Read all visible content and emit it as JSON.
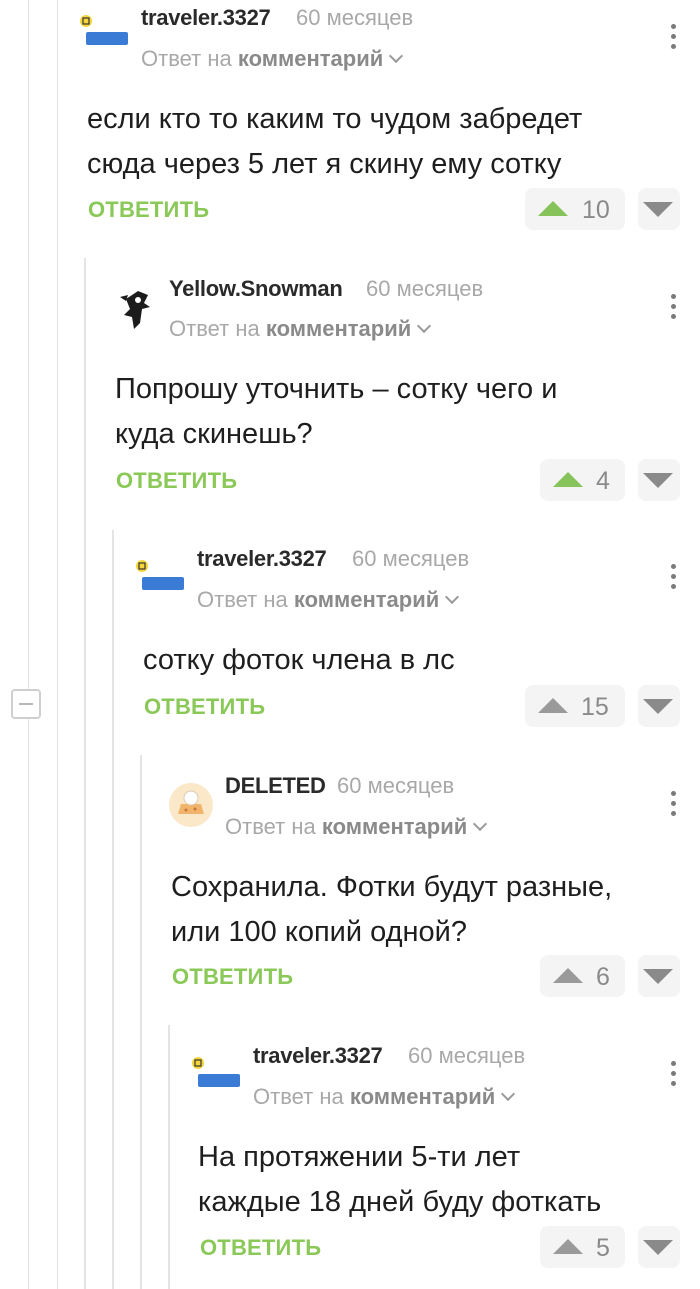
{
  "comments": [
    {
      "username": "traveler.3327",
      "time": "60 месяцев",
      "reply_prefix": "Ответ на",
      "reply_target": "комментарий",
      "text_lines": [
        "если кто то каким то чудом забредет",
        "сюда через 5 лет я скину ему сотку"
      ],
      "reply_label": "ОТВЕТИТЬ",
      "score": "10",
      "voted_up": true
    },
    {
      "username": "Yellow.Snowman",
      "time": "60 месяцев",
      "reply_prefix": "Ответ на",
      "reply_target": "комментарий",
      "text_lines": [
        "Попрошу уточнить – сотку чего и",
        "куда скинешь?"
      ],
      "reply_label": "ОТВЕТИТЬ",
      "score": "4",
      "voted_up": true
    },
    {
      "username": "traveler.3327",
      "time": "60 месяцев",
      "reply_prefix": "Ответ на",
      "reply_target": "комментарий",
      "text_lines": [
        "сотку фоток члена в лс"
      ],
      "reply_label": "ОТВЕТИТЬ",
      "score": "15",
      "voted_up": false
    },
    {
      "username": "DELETED",
      "time": "60 месяцев",
      "reply_prefix": "Ответ на",
      "reply_target": "комментарий",
      "text_lines": [
        "Сохранила. Фотки будут разные,",
        "или 100 копий одной?"
      ],
      "reply_label": "ОТВЕТИТЬ",
      "score": "6",
      "voted_up": false
    },
    {
      "username": "traveler.3327",
      "time": "60 месяцев",
      "reply_prefix": "Ответ на",
      "reply_target": "комментарий",
      "text_lines": [
        "На протяжении 5-ти лет",
        "каждые 18 дней буду фоткать"
      ],
      "reply_label": "ОТВЕТИТЬ",
      "score": "5",
      "voted_up": false
    }
  ],
  "colors": {
    "accent_green": "#8ac858",
    "badge_blue": "#3a7bd5",
    "badge_yellow": "#f4d63a"
  }
}
